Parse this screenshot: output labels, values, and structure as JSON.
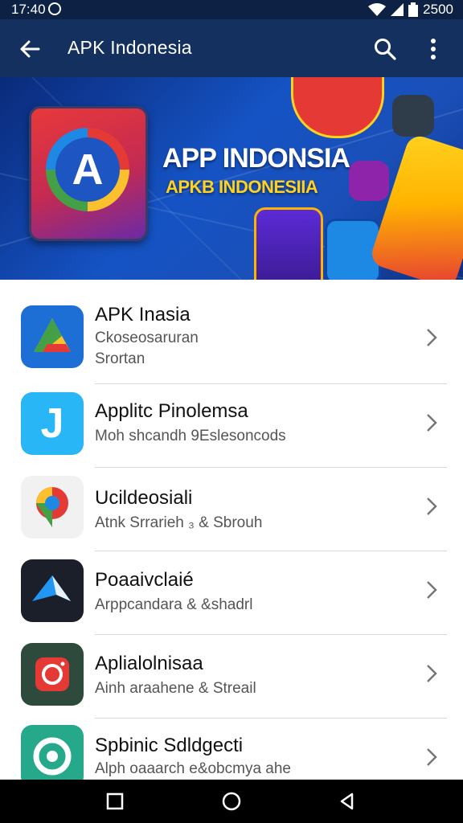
{
  "status_bar": {
    "time": "17:40",
    "battery": "2500"
  },
  "app_bar": {
    "title": "APK Indonesia",
    "back_icon": "arrow-left-icon",
    "search_icon": "search-icon",
    "more_icon": "more-vert-icon"
  },
  "banner": {
    "headline": "APP INDONSIA",
    "subheadline": "APKB INDONESIIA",
    "logo_letter": "A",
    "accent": "#ffd21f"
  },
  "apps": [
    {
      "name": "APK Inasia",
      "line1": "Ckoseosaruran",
      "line2": "Srortan",
      "icon": "google-drive-like-icon"
    },
    {
      "name": "Applitc Pinolemsa",
      "line1": "Moh shcandh 9Eslesoncods",
      "line2": "",
      "icon": "letter-j-icon"
    },
    {
      "name": "Ucildeosiali",
      "line1": "Atnk Srrarieh ₃ & Sbrouh",
      "line2": "",
      "icon": "maps-pin-icon"
    },
    {
      "name": "Poaaivclaié",
      "line1": "Arppcandara & &shadrl",
      "line2": "",
      "icon": "arrow-a-icon"
    },
    {
      "name": "Aplialolnisaa",
      "line1": "Ainh araahene & Streail",
      "line2": "",
      "icon": "camera-icon"
    },
    {
      "name": "Spbinic Sdldgecti",
      "line1": "Alph oaaarch e&obcmya ahe",
      "line2": "",
      "icon": "ring-logo-icon"
    }
  ],
  "nav_bar": {
    "recents_icon": "square-icon",
    "home_icon": "circle-icon",
    "back_icon": "triangle-back-icon"
  }
}
